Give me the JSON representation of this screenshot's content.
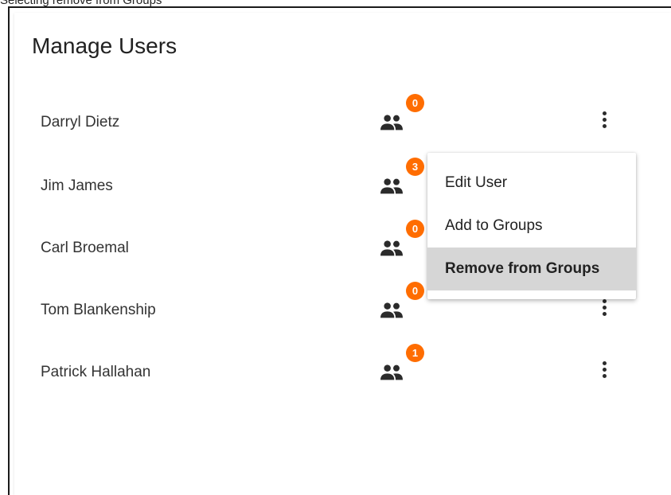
{
  "page": {
    "caption": "Selecting remove from Groups",
    "title": "Manage Users"
  },
  "users": [
    {
      "name": "Darryl Dietz",
      "group_count": "0"
    },
    {
      "name": "Jim James",
      "group_count": "3"
    },
    {
      "name": "Carl Broemal",
      "group_count": "0"
    },
    {
      "name": "Tom Blankenship",
      "group_count": "0"
    },
    {
      "name": "Patrick Hallahan",
      "group_count": "1"
    }
  ],
  "context_menu": {
    "items": [
      {
        "label": "Edit User"
      },
      {
        "label": "Add to Groups"
      },
      {
        "label": "Remove from Groups",
        "highlighted": true
      }
    ]
  },
  "icons": {
    "groups": "people-icon",
    "more": "more-vert-icon"
  },
  "colors": {
    "badge": "#ff6d00",
    "menu_highlight": "#d6d6d6",
    "text": "#333333"
  }
}
